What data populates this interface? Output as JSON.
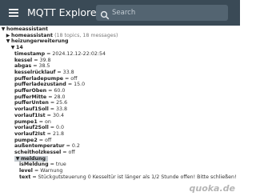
{
  "header": {
    "title": "MQTT Explorer",
    "search_placeholder": "Search",
    "background": "#3a4a56"
  },
  "tree": {
    "root": {
      "label": "homeassistant"
    },
    "child1": {
      "label": "homeassistant",
      "meta": "(18 topics, 18 messages)"
    },
    "heizung": {
      "label": "heizungerweiterung"
    },
    "node14": {
      "label": "14"
    },
    "values": [
      {
        "key": "timestamp",
        "value": "2024.12.12-22:02:54"
      },
      {
        "key": "kessel",
        "value": "39.8"
      },
      {
        "key": "abgas",
        "value": "38.5"
      },
      {
        "key": "kesselrücklauf",
        "value": "33.8"
      },
      {
        "key": "pufferladepumpe",
        "value": "off"
      },
      {
        "key": "pufferladezustand",
        "value": "15.0"
      },
      {
        "key": "pufferOben",
        "value": "60.0"
      },
      {
        "key": "pufferMitte",
        "value": "28.0"
      },
      {
        "key": "pufferUnten",
        "value": "25.6"
      },
      {
        "key": "vorlauf1Soll",
        "value": "33.8"
      },
      {
        "key": "vorlauf1Ist",
        "value": "30.4"
      },
      {
        "key": "pumpe1",
        "value": "on"
      },
      {
        "key": "vorlauf2Soll",
        "value": "0.0"
      },
      {
        "key": "vorlauf2Ist",
        "value": "21.8"
      },
      {
        "key": "pumpe2",
        "value": "off"
      },
      {
        "key": "außentemperatur",
        "value": "0.2"
      },
      {
        "key": "scheitholzkessel",
        "value": "off"
      }
    ],
    "meldung": {
      "label": "meldung",
      "values": [
        {
          "key": "isMeldung",
          "value": "true"
        },
        {
          "key": "level",
          "value": "Warnung"
        },
        {
          "key": "text",
          "value": "Stückgutsteuerung 0 Kesseltür ist länger als 1/2 Stunde offen! Bitte schließen!"
        }
      ]
    }
  },
  "watermark": "quoka.de"
}
